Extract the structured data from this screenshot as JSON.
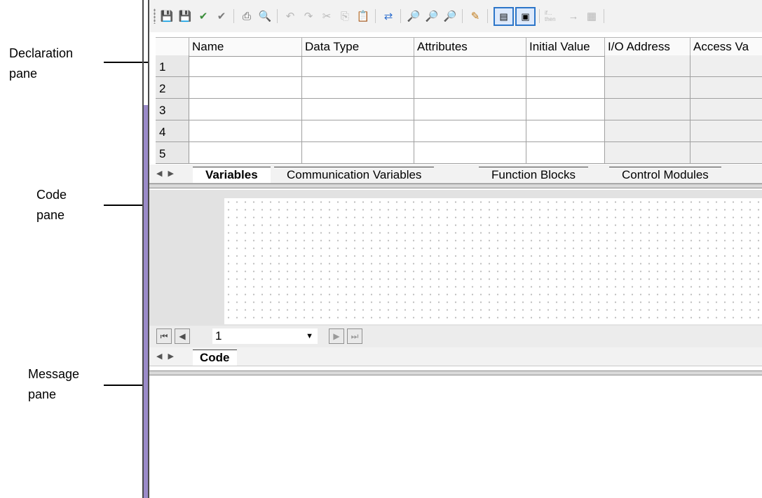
{
  "callouts": {
    "declaration": [
      "Declaration",
      "pane"
    ],
    "code": [
      "Code",
      "pane"
    ],
    "message": [
      "Message",
      "pane"
    ]
  },
  "toolbar": {
    "icons": [
      "save-close-icon",
      "save-icon",
      "check-icon",
      "check-all-icon",
      "print-icon",
      "print-preview-icon",
      "undo-icon",
      "redo-icon",
      "cut-icon",
      "copy-icon",
      "paste-icon",
      "swap-icon",
      "find-icon",
      "find-next-icon",
      "find-replace-icon",
      "bookmark-icon",
      "split-horizontal-icon",
      "split-vertical-icon",
      "if-then-icon",
      "assign-icon",
      "function-block-icon"
    ],
    "if_then_label": "if... then"
  },
  "declaration": {
    "columns": [
      "Name",
      "Data Type",
      "Attributes",
      "Initial Value",
      "I/O Address",
      "Access Va"
    ],
    "rows": [
      "1",
      "2",
      "3",
      "4",
      "5"
    ],
    "tabs": [
      "Variables",
      "Communication Variables",
      "Function Blocks",
      "Control Modules"
    ],
    "active_tab": "Variables"
  },
  "code": {
    "page_value": "1",
    "tabs": [
      "Code"
    ],
    "active_tab": "Code"
  },
  "colors": {
    "frame_accent": "#9b8bc9",
    "pressed_border": "#2d76c9"
  }
}
